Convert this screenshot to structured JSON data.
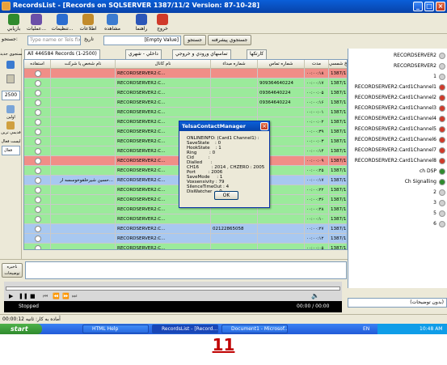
{
  "window": {
    "title": "RecordsList - [Records on SQLSERVER  1387/11/2 Version: 87-10-28]"
  },
  "toolbar": {
    "items": [
      {
        "label": "بازيابي",
        "icon": "restore-icon",
        "color": "#2f8a2d"
      },
      {
        "label": "عمليات...",
        "icon": "operations-icon",
        "color": "#6b4fa8"
      },
      {
        "label": "تنظيمات...",
        "icon": "settings-icon",
        "color": "#2b6dd0"
      },
      {
        "label": "اطلاعات",
        "icon": "info-icon",
        "color": "#c28b2b"
      },
      {
        "label": "مشاهده",
        "icon": "view-icon",
        "color": "#3b7bd0"
      },
      {
        "label": "راهنما",
        "icon": "help-icon",
        "color": "#2b56b8"
      },
      {
        "label": "خروج",
        "icon": "exit-icon",
        "color": "#d03a2a"
      }
    ]
  },
  "search": {
    "label": "جستجو:",
    "placeholder": "Type name or Tels fixer",
    "date_label": "تاريخ",
    "empty_value": "[Empty Value]",
    "search_button": "جستجو",
    "advanced_button": "جستجوي پيشرفته"
  },
  "leftpanel": {
    "search_label": "جستجوي جديد",
    "count_value": "2500",
    "first_label": "اولين",
    "details_label": "قديمي ترين",
    "list_label": "ليست فعال",
    "active_label": "فعال"
  },
  "tabs": [
    {
      "label": "All 446584 Records (1-2500)"
    },
    {
      "label": "داخلي - شهري"
    },
    {
      "label": "تماسهاي ورودي و خروجي"
    },
    {
      "label": "كارتكها"
    }
  ],
  "grid": {
    "columns": [
      "استفاده",
      "نام شخص يا شركت",
      "نام كانال",
      "شماره مبداء",
      "شماره تماس",
      "مدت",
      "تاريخ شمسي"
    ],
    "rows": [
      {
        "color": "#f08e87",
        "name": "",
        "channel": "RECORDSERVER2:C...",
        "from": "",
        "number": "",
        "duration": "۰۰:۰۰:۱۸",
        "date": "1387/11/02"
      },
      {
        "color": "#9bea9b",
        "name": "",
        "channel": "RECORDSERVER2:C...",
        "from": "",
        "number": "909364640224",
        "duration": "۰۰:۰۰:۱۷",
        "date": "1387/11/02"
      },
      {
        "color": "#9bea9b",
        "name": "",
        "channel": "RECORDSERVER2:C...",
        "from": "",
        "number": "09364640224",
        "duration": "۰۰:۰۰:۰۵",
        "date": "1387/11/02"
      },
      {
        "color": "#9bea9b",
        "name": "",
        "channel": "RECORDSERVER2:C...",
        "from": "",
        "number": "09364640224",
        "duration": "۰۰:۰۰:۱۶",
        "date": "1387/11/02"
      },
      {
        "color": "#9bea9b",
        "name": "",
        "channel": "RECORDSERVER2:C...",
        "from": "",
        "number": "",
        "duration": "۰۰:۰۰:۰۱",
        "date": "1387/11/02"
      },
      {
        "color": "#9bea9b",
        "name": "",
        "channel": "RECORDSERVER2:C...",
        "from": "",
        "number": "",
        "duration": "۰۰:۰۰:۰۲",
        "date": "1387/11/02"
      },
      {
        "color": "#9bea9b",
        "name": "",
        "channel": "RECORDSERVER2:C...",
        "from": "",
        "number": "",
        "duration": "۰۰:۰۰:۳۹",
        "date": "1387/11/02"
      },
      {
        "color": "#9bea9b",
        "name": "",
        "channel": "RECORDSERVER2:C...",
        "from": "",
        "number": "",
        "duration": "۰۰:۰۰:۰۳",
        "date": "1387/11/02"
      },
      {
        "color": "#9bea9b",
        "name": "",
        "channel": "RECORDSERVER2:C...",
        "from": "",
        "number": "",
        "duration": "۰۰:۰۰:۱۴",
        "date": "1387/11/02"
      },
      {
        "color": "#f08e87",
        "name": "",
        "channel": "RECORDSERVER2:C...",
        "from": "",
        "number": "",
        "duration": "۰۰:۰۰:۰۹",
        "date": "1387/11/02"
      },
      {
        "color": "#9bea9b",
        "name": "",
        "channel": "RECORDSERVER2:C...",
        "from": "",
        "number": "",
        "duration": "۰۰:۰۰:۲۵",
        "date": "1387/11/02"
      },
      {
        "color": "#a8c8f0",
        "name": "حسين شيرخلقوخوسسه ار...",
        "channel": "RECORDSERVER2:C...",
        "from": "",
        "number": "",
        "duration": "۰۰:۰۰:۱۷",
        "date": "1387/11/02"
      },
      {
        "color": "#9bea9b",
        "name": "",
        "channel": "RECORDSERVER2:C...",
        "from": "",
        "number": "",
        "duration": "۰۰:۰۰:۲۲",
        "date": "1387/11/02"
      },
      {
        "color": "#9bea9b",
        "name": "",
        "channel": "RECORDSERVER2:C...",
        "from": "",
        "number": "",
        "duration": "۰۰:۰۰:۳۶",
        "date": "1387/11/02"
      },
      {
        "color": "#9bea9b",
        "name": "",
        "channel": "RECORDSERVER2:C...",
        "from": "",
        "number": "",
        "duration": "۰۰:۰۰:۲۸",
        "date": "1387/11/02"
      },
      {
        "color": "#9bea9b",
        "name": "",
        "channel": "RECORDSERVER2:C...",
        "from": "",
        "number": "",
        "duration": "۰۰:۰۰:۱۰",
        "date": "1387/11/02"
      },
      {
        "color": "#a8c8f0",
        "name": "",
        "channel": "RECORDSERVER2:C...",
        "from": "02122865058",
        "number": "",
        "duration": "۰۰:۰۰:۲۷",
        "date": "1387/11/02"
      },
      {
        "color": "#a8c8f0",
        "name": "",
        "channel": "RECORDSERVER2:C...",
        "from": "",
        "number": "",
        "duration": "۰۰:۰۰:۱۲",
        "date": "1387/11/02"
      },
      {
        "color": "#9bea9b",
        "name": "",
        "channel": "RECORDSERVER2:C...",
        "from": "",
        "number": "",
        "duration": "۰۰:۰۰:۰۵",
        "date": "1387/11/02"
      }
    ]
  },
  "dialog": {
    "title": "TelsaContactManager",
    "lines": [
      "ONLINEINFO: (Card1 Channel1) :",
      "SaveState    : 0",
      "HookState    : 1",
      "Ring         : 0",
      "Cid          :",
      "Dialled      :",
      "CH16         : 2014 , CHZERO : 2005",
      "Port         : 2006",
      "SaveMode     : 1",
      "Voxsensivity : 79",
      "SilenceTimeOut : 4",
      "DisWatcher   : 0"
    ],
    "ok_label": "OK"
  },
  "notes": {
    "label": "ناخيره توضيحات"
  },
  "player": {
    "status": "Stopped",
    "time": "00:00 / 00:00"
  },
  "statusbar": {
    "text": "آماده به كار: ثانيه 00:00:12"
  },
  "rightpanel": {
    "items": [
      {
        "label": "RECORDSERVER2",
        "icon_color": "#d0d0d0"
      },
      {
        "label": "RECORDSERVER2",
        "icon_color": "#d0d0d0"
      },
      {
        "label": "1",
        "icon_color": "#d0d0d0"
      },
      {
        "label": "RECORDSERVER2:Card1Channel1",
        "icon_color": "#d03a2a"
      },
      {
        "label": "RECORDSERVER2:Card1Channel2",
        "icon_color": "#d03a2a"
      },
      {
        "label": "RECORDSERVER2:Card1Channel3",
        "icon_color": "#d03a2a"
      },
      {
        "label": "RECORDSERVER2:Card1Channel4",
        "icon_color": "#d03a2a"
      },
      {
        "label": "RECORDSERVER2:Card1Channel5",
        "icon_color": "#d03a2a"
      },
      {
        "label": "RECORDSERVER2:Card1Channel6",
        "icon_color": "#d03a2a"
      },
      {
        "label": "RECORDSERVER2:Card1Channel7",
        "icon_color": "#d03a2a"
      },
      {
        "label": "RECORDSERVER2:Card1Channel8",
        "icon_color": "#d03a2a"
      },
      {
        "label": "ch DSP",
        "icon_color": "#2f8a2d"
      },
      {
        "label": "Ch Signalling",
        "icon_color": "#2f8a2d"
      },
      {
        "label": "2",
        "icon_color": "#d0d0d0"
      },
      {
        "label": "3",
        "icon_color": "#d0d0d0"
      },
      {
        "label": "5",
        "icon_color": "#d0d0d0"
      },
      {
        "label": "6",
        "icon_color": "#d0d0d0"
      }
    ],
    "description_label": "(بدون توضيحات)"
  },
  "taskbar": {
    "start_label": "start",
    "tasks": [
      {
        "label": "HTML Help",
        "active": false
      },
      {
        "label": "RecordsList - [Record...",
        "active": true
      },
      {
        "label": "Document1 - Microsof...",
        "active": false
      }
    ],
    "lang": "EN",
    "clock": "10:48 AM"
  },
  "page": {
    "caption": "11"
  }
}
